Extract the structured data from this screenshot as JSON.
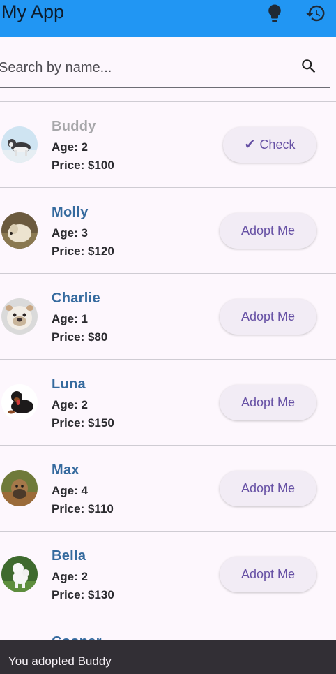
{
  "app_bar": {
    "title": "My App",
    "color": "#2196f3",
    "icons": [
      "lightbulb-icon",
      "history-icon"
    ]
  },
  "search": {
    "placeholder": "Search by name...",
    "value": "",
    "icon": "search-icon"
  },
  "pets": [
    {
      "name": "Buddy",
      "age": "Age: 2",
      "price": "Price: $100",
      "button": "Check",
      "adopted": true
    },
    {
      "name": "Molly",
      "age": "Age: 3",
      "price": "Price: $120",
      "button": "Adopt Me",
      "adopted": false
    },
    {
      "name": "Charlie",
      "age": "Age: 1",
      "price": "Price: $80",
      "button": "Adopt Me",
      "adopted": false
    },
    {
      "name": "Luna",
      "age": "Age: 2",
      "price": "Price: $150",
      "button": "Adopt Me",
      "adopted": false
    },
    {
      "name": "Max",
      "age": "Age: 4",
      "price": "Price: $110",
      "button": "Adopt Me",
      "adopted": false
    },
    {
      "name": "Bella",
      "age": "Age: 2",
      "price": "Price: $130",
      "button": "Adopt Me",
      "adopted": false
    },
    {
      "name": "Cooper"
    }
  ],
  "snackbar": {
    "message": "You adopted Buddy"
  }
}
